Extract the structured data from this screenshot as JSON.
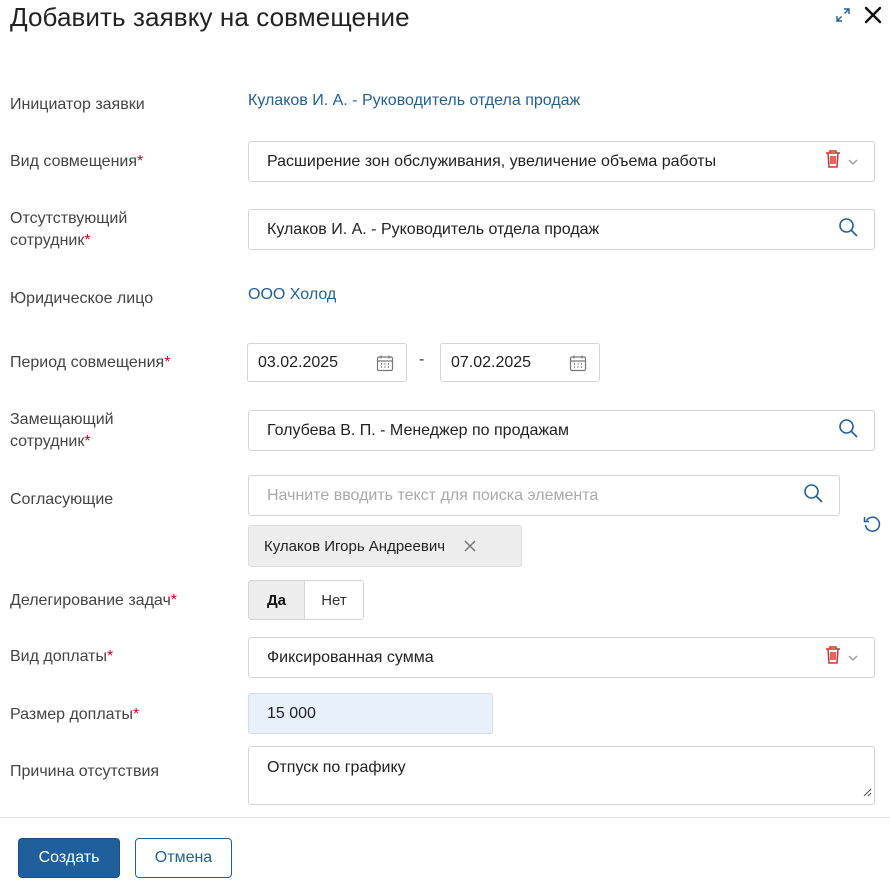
{
  "dialog": {
    "title": "Добавить заявку на совмещение"
  },
  "form": {
    "initiator": {
      "label": "Инициатор заявки",
      "value": "Кулаков И. А. - Руководитель отдела продаж"
    },
    "combination_type": {
      "label": "Вид совмещения",
      "required_mark": "*",
      "value": "Расширение зон обслуживания, увеличение объема работы"
    },
    "absent_employee": {
      "label_line1": "Отсутствующий",
      "label_line2": "сотрудник",
      "required_mark": "*",
      "value": "Кулаков И. А. - Руководитель отдела продаж"
    },
    "legal_entity": {
      "label": "Юридическое лицо",
      "value": "ООО Холод"
    },
    "period": {
      "label": "Период совмещения",
      "required_mark": "*",
      "from": "03.02.2025",
      "separator": "-",
      "to": "07.02.2025"
    },
    "replacing_employee": {
      "label_line1": "Замещающий",
      "label_line2": "сотрудник",
      "required_mark": "*",
      "value": "Голубева В. П. - Менеджер по продажам"
    },
    "approvers": {
      "label": "Согласующие",
      "placeholder": "Начните вводить текст для поиска элемента",
      "selected": [
        "Кулаков Игорь Андреевич"
      ]
    },
    "task_delegation": {
      "label": "Делегирование задач",
      "required_mark": "*",
      "options": [
        "Да",
        "Нет"
      ],
      "selected": "Да"
    },
    "payment_type": {
      "label": "Вид доплаты",
      "required_mark": "*",
      "value": "Фиксированная сумма"
    },
    "payment_amount": {
      "label": "Размер доплаты",
      "required_mark": "*",
      "value": "15 000"
    },
    "absence_reason": {
      "label": "Причина отсутствия",
      "value": "Отпуск по графику"
    }
  },
  "footer": {
    "create_label": "Создать",
    "cancel_label": "Отмена"
  },
  "colors": {
    "link": "#1f5f9c",
    "required": "#d0021b",
    "delete_icon": "#d9342b",
    "primary_button": "#1f5f9c",
    "amount_field_bg": "#e8f0fc"
  },
  "icons": [
    "expand-icon",
    "close-icon",
    "trash-icon",
    "chevron-down-icon",
    "search-icon",
    "calendar-icon",
    "reset-icon",
    "tag-remove-icon",
    "resize-handle-icon"
  ]
}
